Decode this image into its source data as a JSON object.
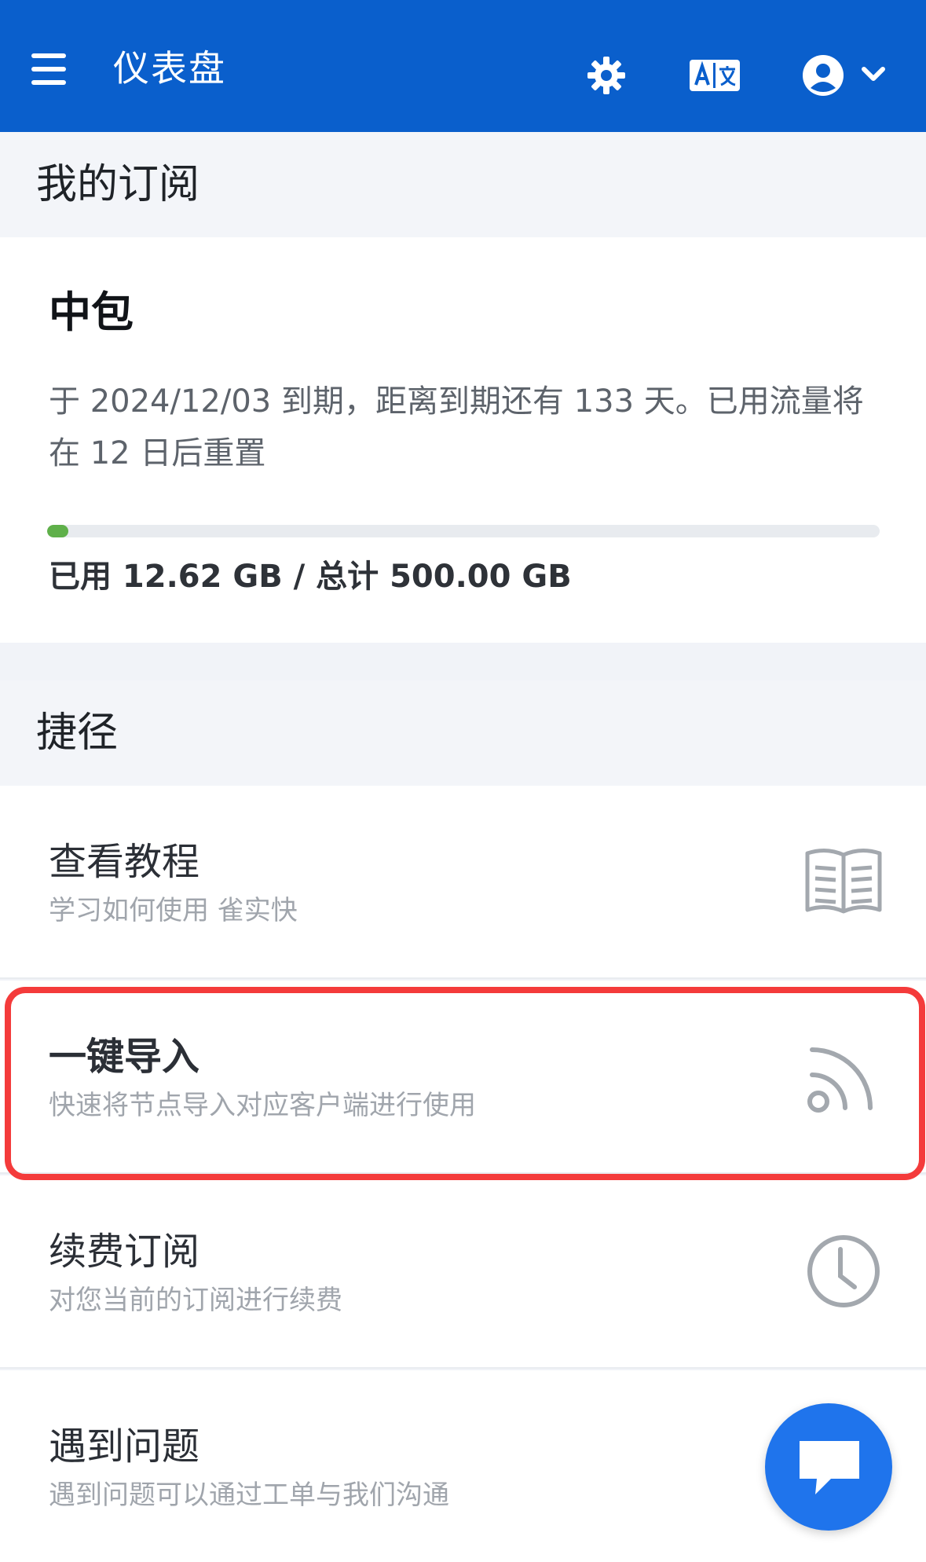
{
  "topbar": {
    "title": "仪表盘",
    "icons": {
      "menu": "hamburger-icon",
      "theme": "gear-icon",
      "language": "translate-icon",
      "account": "user-circle-icon",
      "account_menu": "chevron-down-icon"
    },
    "colors": {
      "background": "#0a5fcc",
      "text": "#ffffff"
    }
  },
  "subscription": {
    "section_title": "我的订阅",
    "plan_name": "中包",
    "description": "于 2024/12/03 到期，距离到期还有 133 天。已用流量将在 12 日后重置",
    "usage_text": "已用 12.62 GB / 总计 500.00 GB",
    "usage_fraction": 0.025,
    "progress_color": "#5fb04a"
  },
  "shortcuts": {
    "section_title": "捷径",
    "items": [
      {
        "title": "查看教程",
        "subtitle": "学习如何使用 雀实快",
        "icon": "book-icon"
      },
      {
        "title": "一键导入",
        "subtitle": "快速将节点导入对应客户端进行使用",
        "icon": "rss-icon"
      },
      {
        "title": "续费订阅",
        "subtitle": "对您当前的订阅进行续费",
        "icon": "clock-icon"
      },
      {
        "title": "遇到问题",
        "subtitle": "遇到问题可以通过工单与我们沟通",
        "icon": "chat-icon"
      }
    ]
  },
  "highlight_color": "#f43b3b",
  "chat_button": {
    "icon": "chat-bubble-icon",
    "color": "#1f74ec"
  }
}
